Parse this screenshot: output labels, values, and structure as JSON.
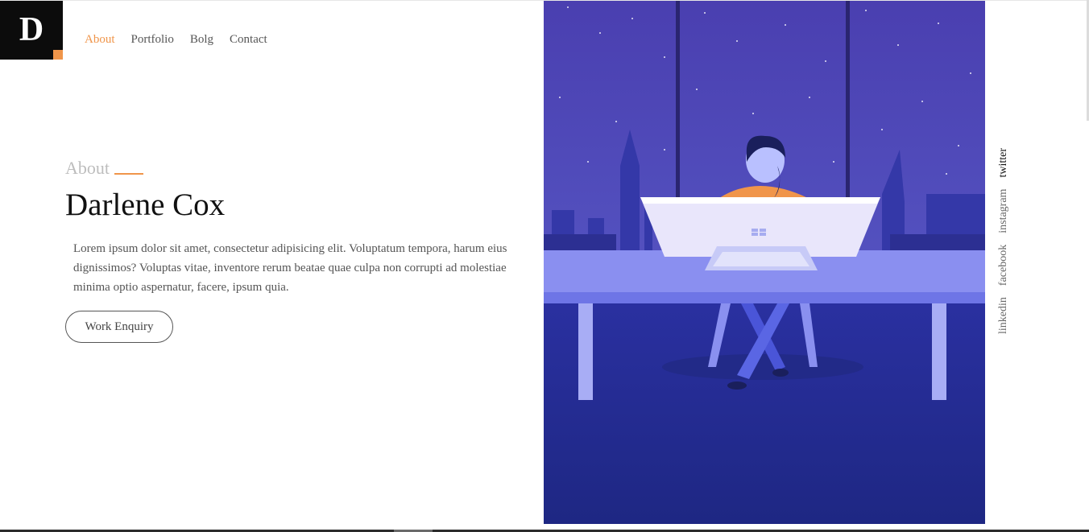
{
  "logo": {
    "letter": "D"
  },
  "nav": {
    "items": [
      "About",
      "Portfolio",
      "Bolg",
      "Contact"
    ],
    "active_index": 0
  },
  "intro": {
    "section_label": "About",
    "name": "Darlene Cox",
    "bio": "Lorem ipsum dolor sit amet, consectetur adipisicing elit. Voluptatum tempora, harum eius dignissimos? Voluptas vitae, inventore rerum beatae quae culpa non corrupti ad molestiae minima optio aspernatur, facere, ipsum quia.",
    "cta_label": "Work Enquiry"
  },
  "social": {
    "items": [
      "twitter",
      "instagram",
      "facebook",
      "linkedin"
    ],
    "active": "twitter"
  },
  "colors": {
    "accent": "#f0954a",
    "hero_top": "#4a45b5",
    "hero_bottom": "#1f2785",
    "desk": "#7c83f0"
  },
  "hero_image": {
    "subject": "woman at desk with computer in front of night city window"
  }
}
